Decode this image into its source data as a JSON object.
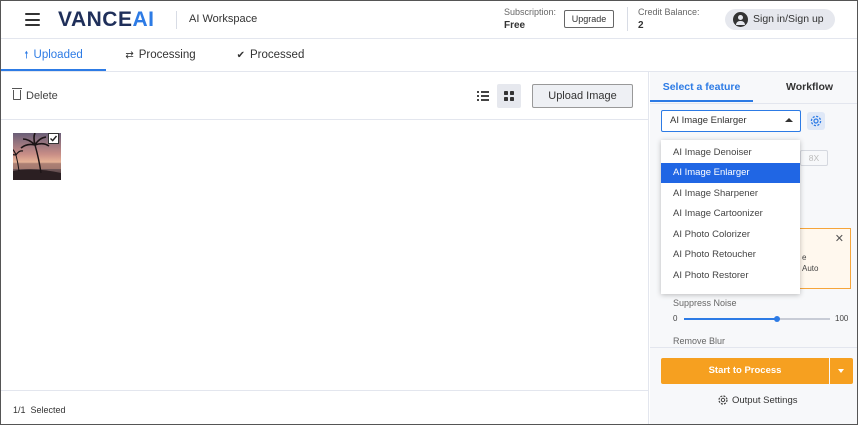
{
  "header": {
    "logo_main": "VANCE",
    "logo_accent": "AI",
    "workspace_title": "AI Workspace",
    "subscription_label": "Subscription:",
    "subscription_value": "Free",
    "upgrade_label": "Upgrade",
    "credit_label": "Credit Balance:",
    "credit_value": "2",
    "signin_label": "Sign in/Sign up"
  },
  "tabs": [
    {
      "label": "Uploaded",
      "icon": "arrow-up-icon",
      "active": true
    },
    {
      "label": "Processing",
      "icon": "refresh-icon",
      "active": false
    },
    {
      "label": "Processed",
      "icon": "check-circle-icon",
      "active": false
    }
  ],
  "toolbar": {
    "delete_label": "Delete",
    "upload_label": "Upload Image"
  },
  "selection": {
    "count_text": "1/1",
    "selected_label": "Selected"
  },
  "right_panel": {
    "tab_feature": "Select a feature",
    "tab_workflow": "Workflow",
    "selected_feature": "AI Image Enlarger",
    "scale_option": "8X",
    "notice_line1": "e",
    "notice_line2": "Auto",
    "suppress_noise_label": "Suppress Noise",
    "slider_min": "0",
    "slider_max": "100",
    "slider_value_fraction": 0.64,
    "remove_blur_label": "Remove Blur",
    "process_label": "Start to Process",
    "output_settings_label": "Output Settings"
  },
  "dropdown": {
    "items": [
      "AI Image Denoiser",
      "AI Image Enlarger",
      "AI Image Sharpener",
      "AI Image Cartoonizer",
      "AI Photo Colorizer",
      "AI Photo Retoucher",
      "AI Photo Restorer"
    ],
    "active_index": 1
  },
  "colors": {
    "accent": "#2d7be5",
    "orange": "#f6a020",
    "dropdown_active": "#2066e4"
  }
}
